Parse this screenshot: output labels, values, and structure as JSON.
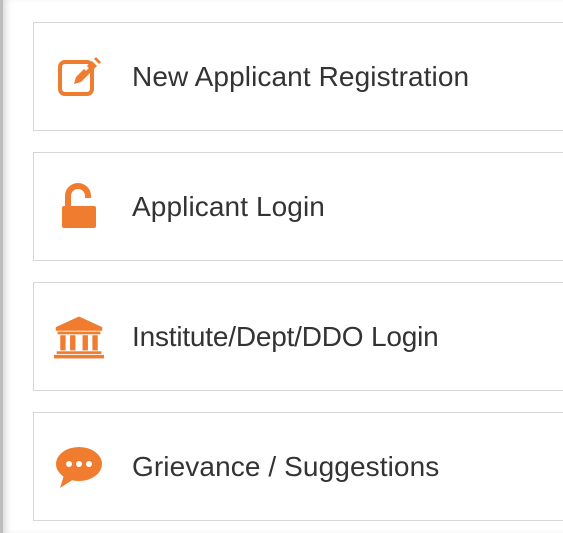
{
  "colors": {
    "accent": "#f07c2f",
    "text": "#333333",
    "border": "#d6d6d6"
  },
  "menu": {
    "items": [
      {
        "label": "New Applicant Registration",
        "icon": "edit-icon"
      },
      {
        "label": "Applicant Login",
        "icon": "unlock-icon"
      },
      {
        "label": "Institute/Dept/DDO Login",
        "icon": "institution-icon"
      },
      {
        "label": "Grievance / Suggestions",
        "icon": "chat-bubble-icon"
      }
    ]
  }
}
